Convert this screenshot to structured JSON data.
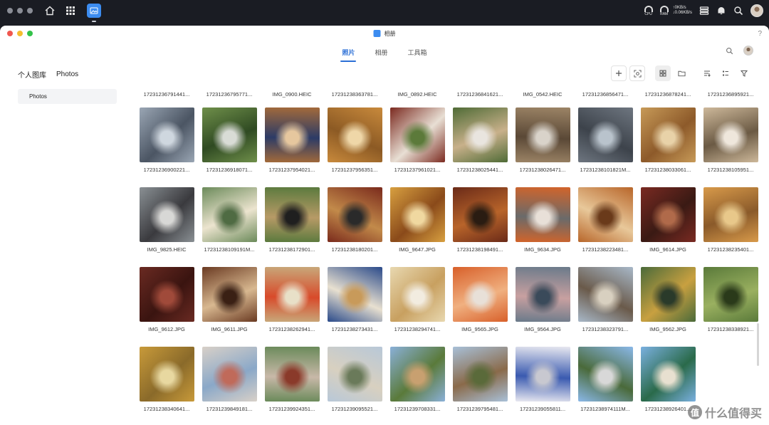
{
  "window": {
    "title": "相册",
    "help_label": "?"
  },
  "tabs": [
    {
      "label": "照片",
      "active": true
    },
    {
      "label": "相册",
      "active": false
    },
    {
      "label": "工具箱",
      "active": false
    }
  ],
  "system": {
    "cpu_label": "CPU",
    "ram_label": "RAM",
    "net_up": "↑0KB/s",
    "net_down": "↓0.06KB/s"
  },
  "toolbar": {
    "library_label": "个人图库",
    "folder_label": "Photos"
  },
  "sidebar": {
    "items": [
      {
        "label": "Photos",
        "active": true
      }
    ]
  },
  "photos": {
    "top_row_labels": [
      "17231236791441...",
      "17231236795771...",
      "IMG_0900.HEIC",
      "17231238363781...",
      "IMG_0892.HEIC",
      "17231236841621...",
      "IMG_0542.HEIC",
      "17231236856471...",
      "17231236878241...",
      "17231236895921..."
    ],
    "rows": [
      [
        {
          "label": "17231236900221...",
          "colors": [
            "#9aa6b4",
            "#4b5563",
            "#cfd7df"
          ]
        },
        {
          "label": "17231236918071...",
          "colors": [
            "#6f8f4a",
            "#2f4a22",
            "#d9dcd6"
          ]
        },
        {
          "label": "17231237954021...",
          "colors": [
            "#a36a3a",
            "#2c3b66",
            "#e6c79e"
          ]
        },
        {
          "label": "17231237956351...",
          "colors": [
            "#c98a3c",
            "#8c5a24",
            "#efd7a8"
          ]
        },
        {
          "label": "17231237961021...",
          "colors": [
            "#7b2a20",
            "#e8dfd4",
            "#5c7a3a"
          ]
        },
        {
          "label": "17231238025441...",
          "colors": [
            "#4f6b36",
            "#c8b08a",
            "#e9e5df"
          ]
        },
        {
          "label": "17231238026471...",
          "colors": [
            "#9c8466",
            "#5a4836",
            "#d9d3ca"
          ]
        },
        {
          "label": "17231238101821M...",
          "colors": [
            "#6e7680",
            "#3d434b",
            "#b9c3cc"
          ]
        },
        {
          "label": "17231238033061...",
          "colors": [
            "#c79a58",
            "#8d5a2a",
            "#e8d2a8"
          ]
        },
        {
          "label": "17231238105951...",
          "colors": [
            "#cdb89a",
            "#6b5a44",
            "#efe7dc"
          ]
        }
      ],
      [
        {
          "label": "IMG_9825.HEIC",
          "colors": [
            "#8a9094",
            "#3a3a3e",
            "#d8d8d6"
          ]
        },
        {
          "label": "17231238109191M...",
          "colors": [
            "#6b8a5a",
            "#ece4cf",
            "#4f6b43"
          ]
        },
        {
          "label": "17231238172901...",
          "colors": [
            "#5b7a3e",
            "#b79a66",
            "#1f1f1f"
          ]
        },
        {
          "label": "17231238180201...",
          "colors": [
            "#7a2a1c",
            "#c28a4a",
            "#2a2a2a"
          ]
        },
        {
          "label": "IMG_9647.JPG",
          "colors": [
            "#d8a040",
            "#8a4a1a",
            "#f0d8a0"
          ]
        },
        {
          "label": "17231238198491...",
          "colors": [
            "#6a2a18",
            "#b8642a",
            "#2a1c12"
          ]
        },
        {
          "label": "IMG_9634.JPG",
          "colors": [
            "#d2642a",
            "#6a6a6a",
            "#e8e0d8"
          ]
        },
        {
          "label": "17231238223481...",
          "colors": [
            "#b8662a",
            "#e8c89a",
            "#6a3a1a"
          ]
        },
        {
          "label": "IMG_9614.JPG",
          "colors": [
            "#7a2a22",
            "#3a1a14",
            "#b06a4a"
          ]
        },
        {
          "label": "17231238235401...",
          "colors": [
            "#d89a4a",
            "#8a5a2a",
            "#e8c88a"
          ]
        }
      ],
      [
        {
          "label": "IMG_9612.JPG",
          "colors": [
            "#6a2a22",
            "#3a1410",
            "#a04a3a"
          ]
        },
        {
          "label": "IMG_9611.JPG",
          "colors": [
            "#6a3a22",
            "#d8b890",
            "#3a2014"
          ]
        },
        {
          "label": "17231238262941...",
          "colors": [
            "#c8a87a",
            "#d84a2a",
            "#e8e0c8"
          ]
        },
        {
          "label": "17231238273431...",
          "colors": [
            "#2a4a8a",
            "#e8e0d0",
            "#c89a5a"
          ]
        },
        {
          "label": "17231238294741...",
          "colors": [
            "#e8d8b0",
            "#c8a060",
            "#f2ece0"
          ]
        },
        {
          "label": "IMG_9565.JPG",
          "colors": [
            "#d8602a",
            "#f0b080",
            "#e8e0d8"
          ]
        },
        {
          "label": "IMG_9564.JPG",
          "colors": [
            "#6a7a8a",
            "#c8a0a0",
            "#3a4a5a"
          ]
        },
        {
          "label": "17231238323791...",
          "colors": [
            "#a8b8c8",
            "#6a5a4a",
            "#d8d0c0"
          ]
        },
        {
          "label": "IMG_9562.JPG",
          "colors": [
            "#4a6a3a",
            "#c8a040",
            "#2a3a2a"
          ]
        },
        {
          "label": "17231238338921...",
          "colors": [
            "#5a7a3a",
            "#9ab060",
            "#2a3a1a"
          ]
        }
      ],
      [
        {
          "label": "17231238340641...",
          "colors": [
            "#c89a3a",
            "#8a6a2a",
            "#e8d8a0"
          ]
        },
        {
          "label": "17231239849181...",
          "colors": [
            "#d8d0c8",
            "#8aa8c8",
            "#c06a5a"
          ]
        },
        {
          "label": "17231239924351...",
          "colors": [
            "#6a8a5a",
            "#c8b8a8",
            "#8a3a2a"
          ]
        },
        {
          "label": "17231239095521...",
          "colors": [
            "#b8c8d8",
            "#d8d0c0",
            "#6a7a5a"
          ]
        },
        {
          "label": "17231239708331...",
          "colors": [
            "#8ab0d8",
            "#5a7a3a",
            "#c8a070"
          ]
        },
        {
          "label": "17231239795481...",
          "colors": [
            "#a8c0d8",
            "#8a6a4a",
            "#5a6a3a"
          ]
        },
        {
          "label": "17231239055811...",
          "colors": [
            "#e8e8f0",
            "#3a5ab0",
            "#c8c8d0"
          ]
        },
        {
          "label": "17231238974111M...",
          "colors": [
            "#8ab8e8",
            "#4a6a3a",
            "#d8d8d8"
          ]
        },
        {
          "label": "17231238926401...",
          "colors": [
            "#7ab0e0",
            "#2a6a4a",
            "#e8e0d0"
          ]
        }
      ]
    ]
  },
  "watermark": {
    "logo_char": "值",
    "text": "什么值得买"
  }
}
